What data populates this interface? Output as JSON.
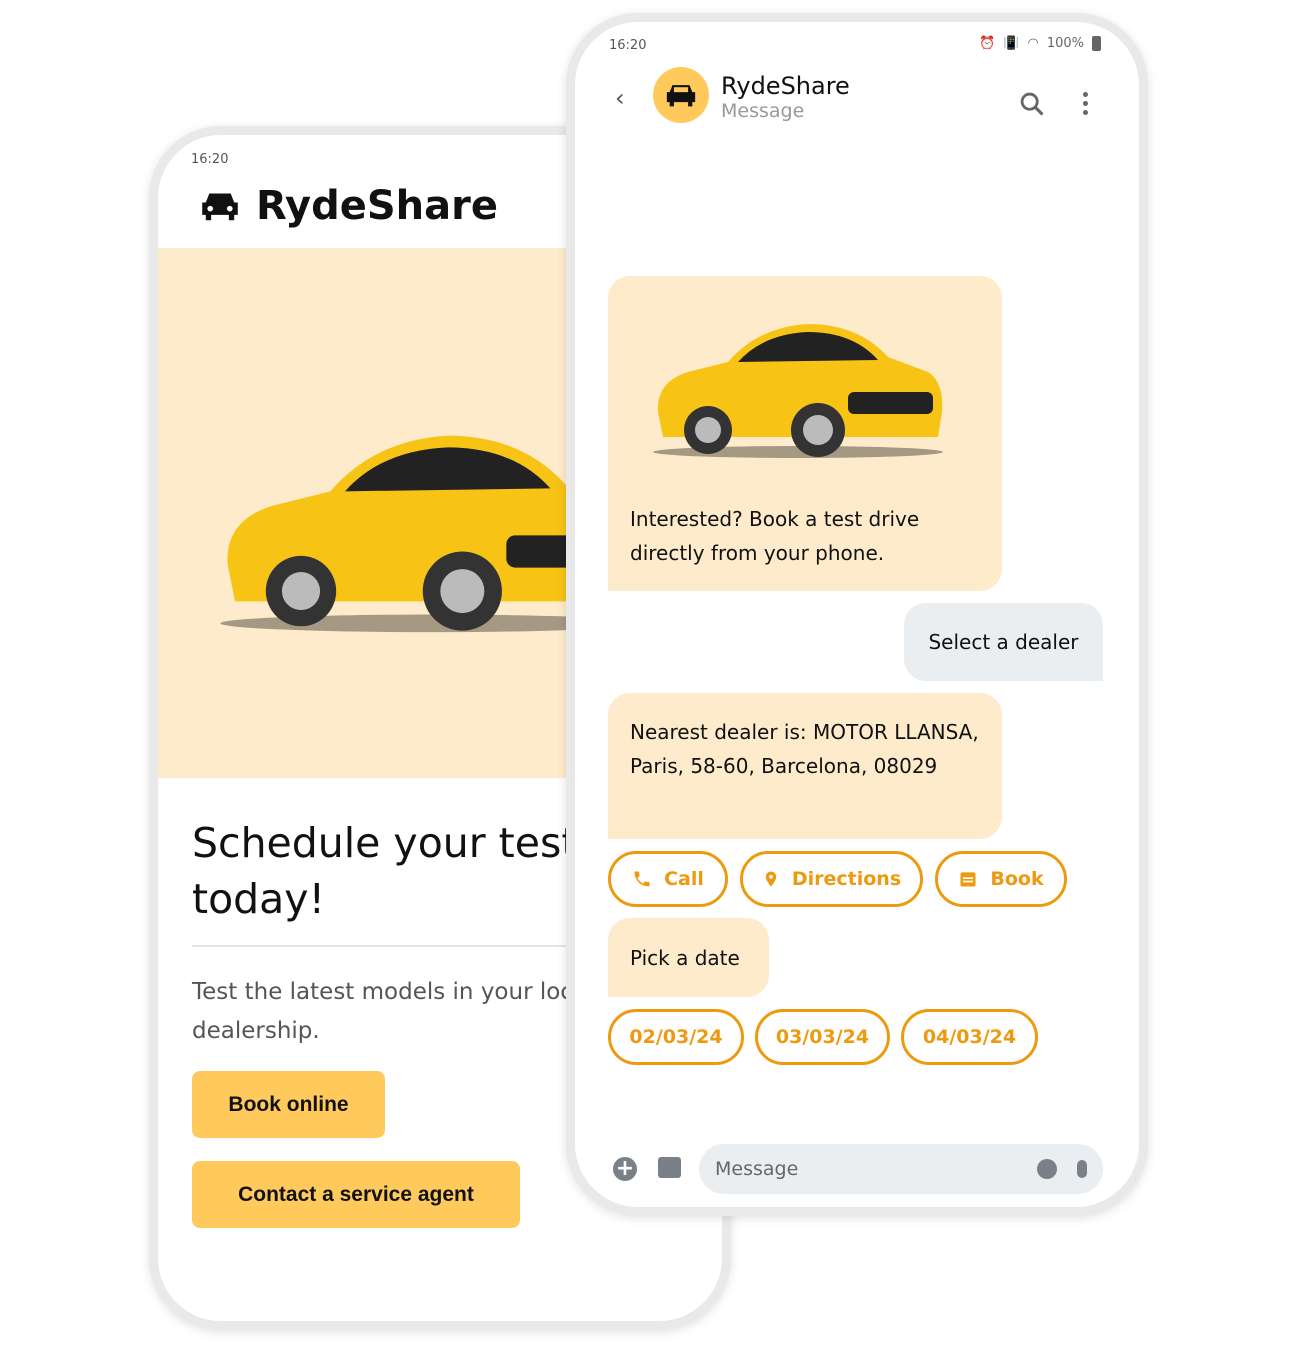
{
  "colors": {
    "accent": "#ee9a10",
    "bubble": "#fdebcb",
    "button": "#ffc95c"
  },
  "landing": {
    "status_time": "16:20",
    "brand": "RydeShare",
    "headline_line1": "Schedule your test drive",
    "headline_line2": "today!",
    "body_line1": "Test the latest models in your local",
    "body_line2": "dealership.",
    "book_online": "Book online",
    "contact_agent": "Contact a service agent"
  },
  "chat": {
    "status_time": "16:20",
    "battery": "100%",
    "title": "RydeShare",
    "subtitle": "Message",
    "messages": [
      {
        "text": "Interested? Book a test drive directly from your phone."
      },
      {
        "text": "Select a dealer"
      },
      {
        "text": "Nearest dealer is: MOTOR LLANSA, Paris, 58-60, Barcelona, 08029"
      },
      {
        "text": "Pick a date"
      }
    ],
    "actions": [
      {
        "label": "Call",
        "icon": "phone-icon"
      },
      {
        "label": "Directions",
        "icon": "map-pin-icon"
      },
      {
        "label": "Book",
        "icon": "calendar-icon"
      }
    ],
    "dates": [
      "02/03/24",
      "03/03/24",
      "04/03/24"
    ],
    "input_placeholder": "Message"
  }
}
